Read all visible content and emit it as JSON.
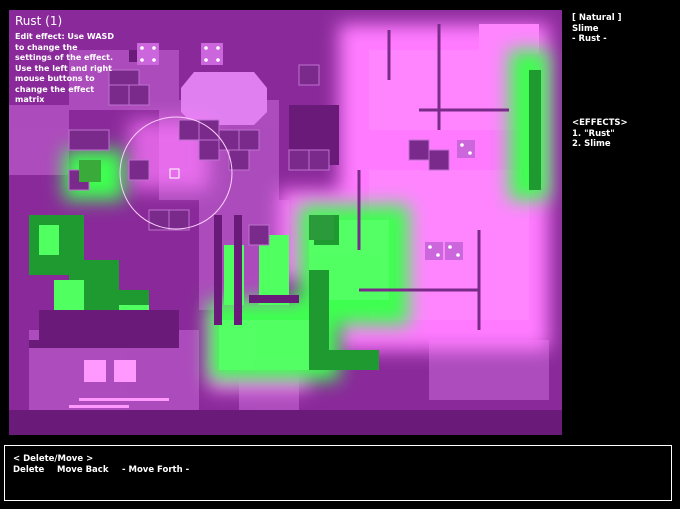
{
  "effect_panel": {
    "title": "Rust (1)",
    "help_lines": [
      "Edit effect: Use WASD",
      "to change the",
      "settings of the effect.",
      "Use the left and right",
      "mouse buttons to",
      "change the effect",
      "matrix"
    ]
  },
  "palette": {
    "label": "[ Natural ]",
    "items": [
      "Slime",
      "- Rust -"
    ]
  },
  "effects": {
    "header": "<EFFECTS>",
    "items": [
      "1. \"Rust\"",
      "2. Slime"
    ]
  },
  "actions": {
    "header": "< Delete/Move >",
    "delete": "Delete",
    "move_back": "Move Back",
    "move_forth": "- Move Forth -"
  },
  "colors": {
    "background": "#000000",
    "wall": "#8a2a9a",
    "wall_light": "#c060d0",
    "rust": "#ff80ff",
    "slime": "#44ff55",
    "slime_dark": "#1a8a2a"
  }
}
